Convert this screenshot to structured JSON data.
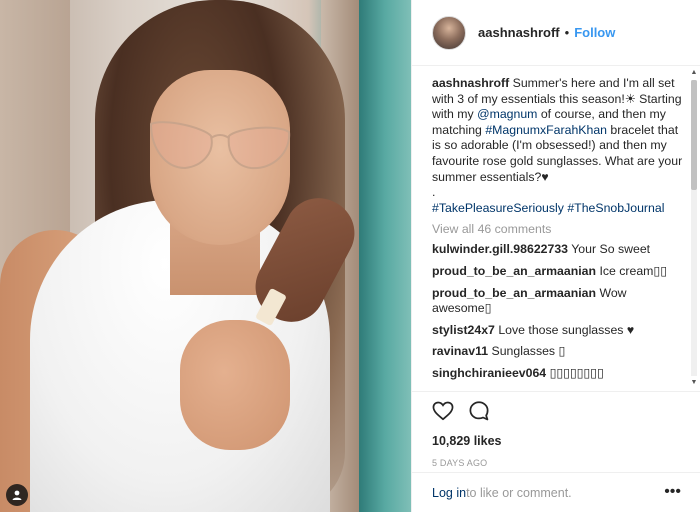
{
  "post": {
    "username": "aashnashroff",
    "follow_label": "Follow",
    "caption": {
      "user": "aashnashroff",
      "text_1": " Summer's here and I'm all set with 3 of my essentials this season!☀ Starting with my ",
      "mention": "@magnum",
      "text_2": " of course, and then my matching ",
      "hashtag_1": "#MagnumxFarahKhan",
      "text_3": " bracelet that is so adorable (I'm obsessed!) and then my favourite rose gold sunglasses. What are your summer essentials?♥",
      "dot": ".",
      "hashtag_2": "#TakePleasureSeriously",
      "hashtag_3": "#TheSnobJournal"
    },
    "view_all_comments": "View all 46 comments",
    "comments": [
      {
        "user": "kulwinder.gill.98622733",
        "text": "Your So sweet"
      },
      {
        "user": "proud_to_be_an_armaanian",
        "text": "Ice cream▯▯"
      },
      {
        "user": "proud_to_be_an_armaanian",
        "text": "Wow awesome▯"
      },
      {
        "user": "stylist24x7",
        "text": "Love those sunglasses ♥"
      },
      {
        "user": "ravinav11",
        "text": "Sunglasses ▯"
      },
      {
        "user": "singhchiranieev064",
        "text": "▯▯▯▯▯▯▯▯"
      }
    ],
    "likes": "10,829 likes",
    "date": "5 DAYS AGO",
    "login_link": "Log in",
    "login_text": " to like or comment.",
    "more_label": "•••"
  },
  "icons": {
    "heart": "heart-icon",
    "comment": "comment-icon",
    "user_tag": "user-tag-icon"
  }
}
